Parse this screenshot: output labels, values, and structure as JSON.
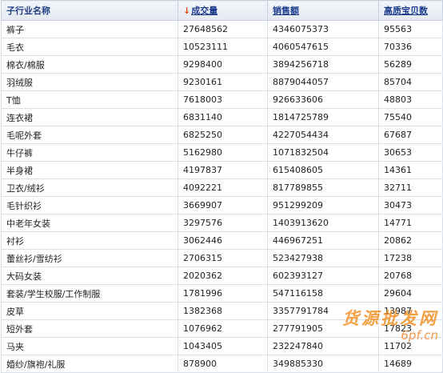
{
  "table": {
    "headers": {
      "category": "子行业名称",
      "sort_arrow": "↓",
      "volume": "成交量",
      "sales": "销售额",
      "top_items": "高质宝贝数"
    },
    "rows": [
      {
        "name": "裤子",
        "volume": "27648562",
        "sales": "4346075373",
        "items": "95563"
      },
      {
        "name": "毛衣",
        "volume": "10523111",
        "sales": "4060547615",
        "items": "70336"
      },
      {
        "name": "棉衣/棉服",
        "volume": "9298400",
        "sales": "3894256718",
        "items": "56289"
      },
      {
        "name": "羽绒服",
        "volume": "9230161",
        "sales": "8879044057",
        "items": "85704"
      },
      {
        "name": "T恤",
        "volume": "7618003",
        "sales": "926633606",
        "items": "48803"
      },
      {
        "name": "连衣裙",
        "volume": "6831140",
        "sales": "1814725789",
        "items": "75540"
      },
      {
        "name": "毛呢外套",
        "volume": "6825250",
        "sales": "4227054434",
        "items": "67687"
      },
      {
        "name": "牛仔裤",
        "volume": "5162980",
        "sales": "1071832504",
        "items": "30653"
      },
      {
        "name": "半身裙",
        "volume": "4197837",
        "sales": "615408605",
        "items": "14361"
      },
      {
        "name": "卫衣/绒衫",
        "volume": "4092221",
        "sales": "817789855",
        "items": "32711"
      },
      {
        "name": "毛针织衫",
        "volume": "3669907",
        "sales": "951299209",
        "items": "30473"
      },
      {
        "name": "中老年女装",
        "volume": "3297576",
        "sales": "1403913620",
        "items": "14771"
      },
      {
        "name": "衬衫",
        "volume": "3062446",
        "sales": "446967251",
        "items": "20862"
      },
      {
        "name": "蕾丝衫/雪纺衫",
        "volume": "2706315",
        "sales": "523427938",
        "items": "17238"
      },
      {
        "name": "大码女装",
        "volume": "2020362",
        "sales": "602393127",
        "items": "20768"
      },
      {
        "name": "套装/学生校服/工作制服",
        "volume": "1781996",
        "sales": "547116158",
        "items": "29604"
      },
      {
        "name": "皮草",
        "volume": "1382368",
        "sales": "3357791784",
        "items": "13987"
      },
      {
        "name": "短外套",
        "volume": "1076962",
        "sales": "277791905",
        "items": "17823"
      },
      {
        "name": "马夹",
        "volume": "1043405",
        "sales": "232247840",
        "items": "11702"
      },
      {
        "name": "婚纱/旗袍/礼服",
        "volume": "878900",
        "sales": "349885330",
        "items": "14689"
      }
    ]
  },
  "watermark": {
    "text": "货源批发网",
    "url": "6pf.cn"
  }
}
